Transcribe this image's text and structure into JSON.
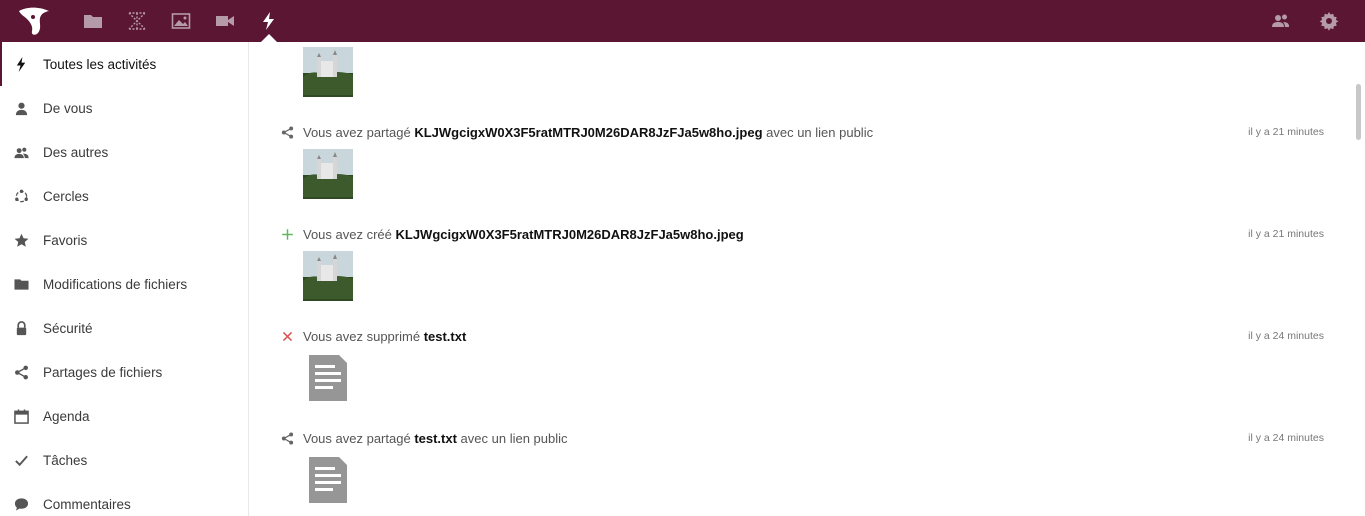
{
  "topbar": {
    "apps": [
      {
        "name": "files",
        "icon": "folder-icon"
      },
      {
        "name": "gallery",
        "icon": "image-icon"
      },
      {
        "name": "deck",
        "icon": "network-icon"
      },
      {
        "name": "video",
        "icon": "video-icon"
      },
      {
        "name": "activity",
        "icon": "lightning-icon"
      }
    ],
    "bg_color": "#5b1634"
  },
  "sidebar": {
    "items": [
      {
        "label": "Toutes les activités",
        "icon": "lightning-icon"
      },
      {
        "label": "De vous",
        "icon": "user-icon"
      },
      {
        "label": "Des autres",
        "icon": "users-icon"
      },
      {
        "label": "Cercles",
        "icon": "circles-icon"
      },
      {
        "label": "Favoris",
        "icon": "star-icon"
      },
      {
        "label": "Modifications de fichiers",
        "icon": "folder-icon"
      },
      {
        "label": "Sécurité",
        "icon": "lock-icon"
      },
      {
        "label": "Partages de fichiers",
        "icon": "share-icon"
      },
      {
        "label": "Agenda",
        "icon": "calendar-icon"
      },
      {
        "label": "Tâches",
        "icon": "checkmark-icon"
      },
      {
        "label": "Commentaires",
        "icon": "comment-icon"
      }
    ]
  },
  "activities": [
    {
      "pre": "Vous avez partagé ",
      "file": "KLJWgcigxW0X3F5ratMTRJ0M26DAR8JzFJa5w8ho.jpeg",
      "post": " avec un lien public",
      "time": "il y a 21 minutes",
      "icon": "share-icon"
    },
    {
      "pre": "Vous avez créé ",
      "file": "KLJWgcigxW0X3F5ratMTRJ0M26DAR8JzFJa5w8ho.jpeg",
      "post": "",
      "time": "il y a 21 minutes",
      "icon": "plus-icon"
    },
    {
      "pre": "Vous avez supprimé ",
      "file": "test.txt",
      "post": "",
      "time": "il y a 24 minutes",
      "icon": "close-icon"
    },
    {
      "pre": "Vous avez partagé ",
      "file": "test.txt",
      "post": " avec un lien public",
      "time": "il y a 24 minutes",
      "icon": "share-icon"
    }
  ]
}
